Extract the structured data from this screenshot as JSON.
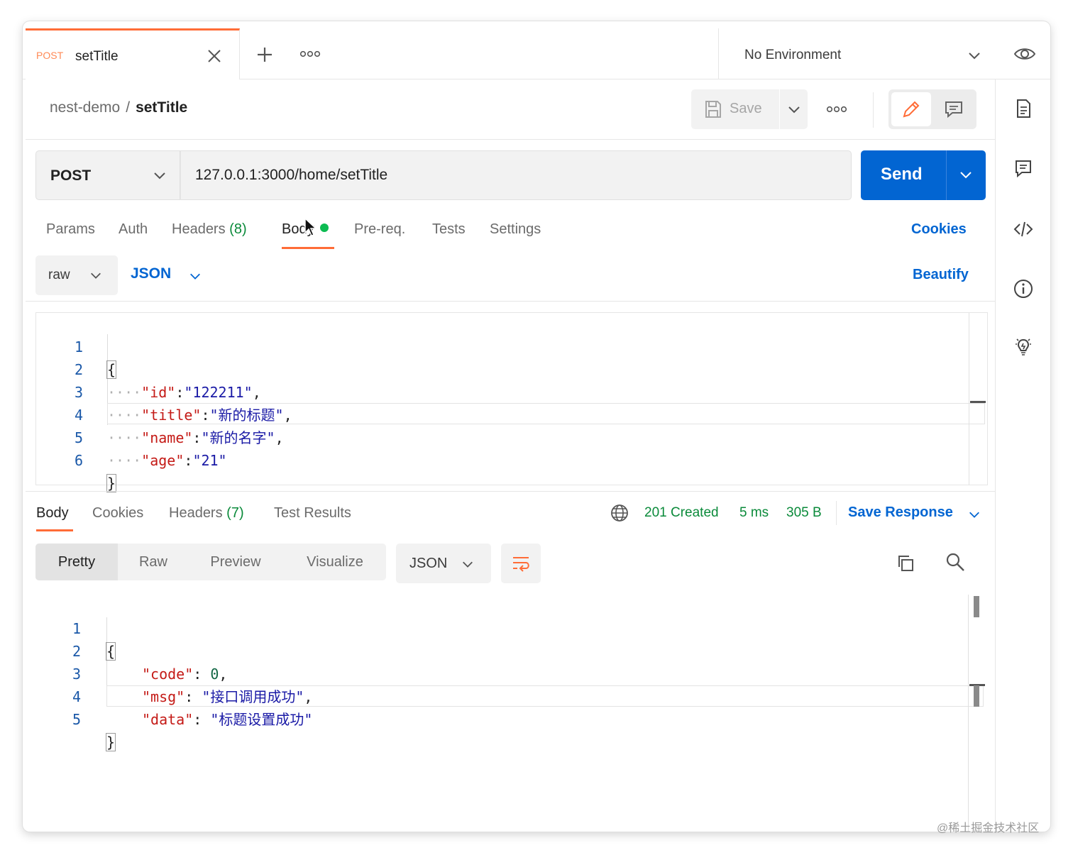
{
  "tab": {
    "method": "POST",
    "name": "setTitle"
  },
  "environment": {
    "label": "No Environment"
  },
  "breadcrumb": {
    "parent": "nest-demo",
    "separator": "/",
    "current": "setTitle"
  },
  "header": {
    "save_label": "Save"
  },
  "request": {
    "method": "POST",
    "url": "127.0.0.1:3000/home/setTitle",
    "send_label": "Send"
  },
  "request_tabs": {
    "params": "Params",
    "auth": "Auth",
    "headers": "Headers",
    "headers_count": "(8)",
    "body": "Body",
    "prereq": "Pre-req.",
    "tests": "Tests",
    "settings": "Settings",
    "cookies": "Cookies"
  },
  "body_options": {
    "mode": "raw",
    "format": "JSON",
    "beautify": "Beautify"
  },
  "request_body": {
    "line_numbers": [
      "1",
      "2",
      "3",
      "4",
      "5",
      "6"
    ],
    "open_brace": "{",
    "close_brace": "}",
    "fields": [
      {
        "key": "\"id\"",
        "value": "\"122211\"",
        "trail": ","
      },
      {
        "key": "\"title\"",
        "value": "\"新的标题\"",
        "trail": ","
      },
      {
        "key": "\"name\"",
        "value": "\"新的名字\"",
        "trail": ","
      },
      {
        "key": "\"age\"",
        "value": "\"21\"",
        "trail": ""
      }
    ],
    "indent_dots": "····"
  },
  "response_tabs": {
    "body": "Body",
    "cookies": "Cookies",
    "headers": "Headers",
    "headers_count": "(7)",
    "test_results": "Test Results"
  },
  "response_status": {
    "status": "201 Created",
    "time": "5 ms",
    "size": "305 B",
    "save_response": "Save Response"
  },
  "response_view": {
    "pretty": "Pretty",
    "raw": "Raw",
    "preview": "Preview",
    "visualize": "Visualize",
    "format": "JSON"
  },
  "response_body": {
    "line_numbers": [
      "1",
      "2",
      "3",
      "4",
      "5"
    ],
    "open_brace": "{",
    "close_brace": "}",
    "fields": [
      {
        "key": "\"code\"",
        "value": "0",
        "trail": ","
      },
      {
        "key": "\"msg\"",
        "value": "\"接口调用成功\"",
        "trail": ","
      },
      {
        "key": "\"data\"",
        "value": "\"标题设置成功\"",
        "trail": ""
      }
    ]
  },
  "watermark": "@稀土掘金技术社区",
  "colors": {
    "accent": "#ff6c37",
    "primary": "#0265d2",
    "success": "#0a8a3a"
  }
}
